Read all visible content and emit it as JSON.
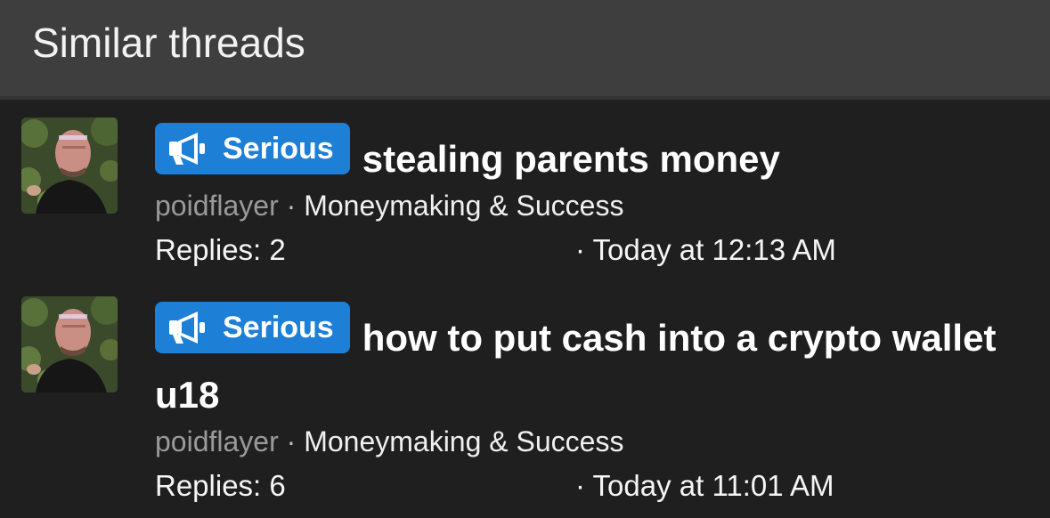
{
  "block": {
    "title": "Similar threads"
  },
  "threads": [
    {
      "prefix_label": "Serious",
      "prefix_icon": "megaphone-icon",
      "title": "stealing parents money",
      "author": "poidflayer",
      "separator": "·",
      "forum": "Moneymaking & Success",
      "replies": "Replies: 2",
      "date": "· Today at 12:13 AM"
    },
    {
      "prefix_label": "Serious",
      "prefix_icon": "megaphone-icon",
      "title": "how to put cash into a crypto wallet u18",
      "author": "poidflayer",
      "separator": "·",
      "forum": "Moneymaking & Success",
      "replies": "Replies: 6",
      "date": "· Today at 11:01 AM"
    }
  ],
  "colors": {
    "prefix_background": "#1e7fd6",
    "header_background": "#3e3e3e",
    "body_background": "#1f1f1f",
    "author_text": "#9a9a9a"
  }
}
